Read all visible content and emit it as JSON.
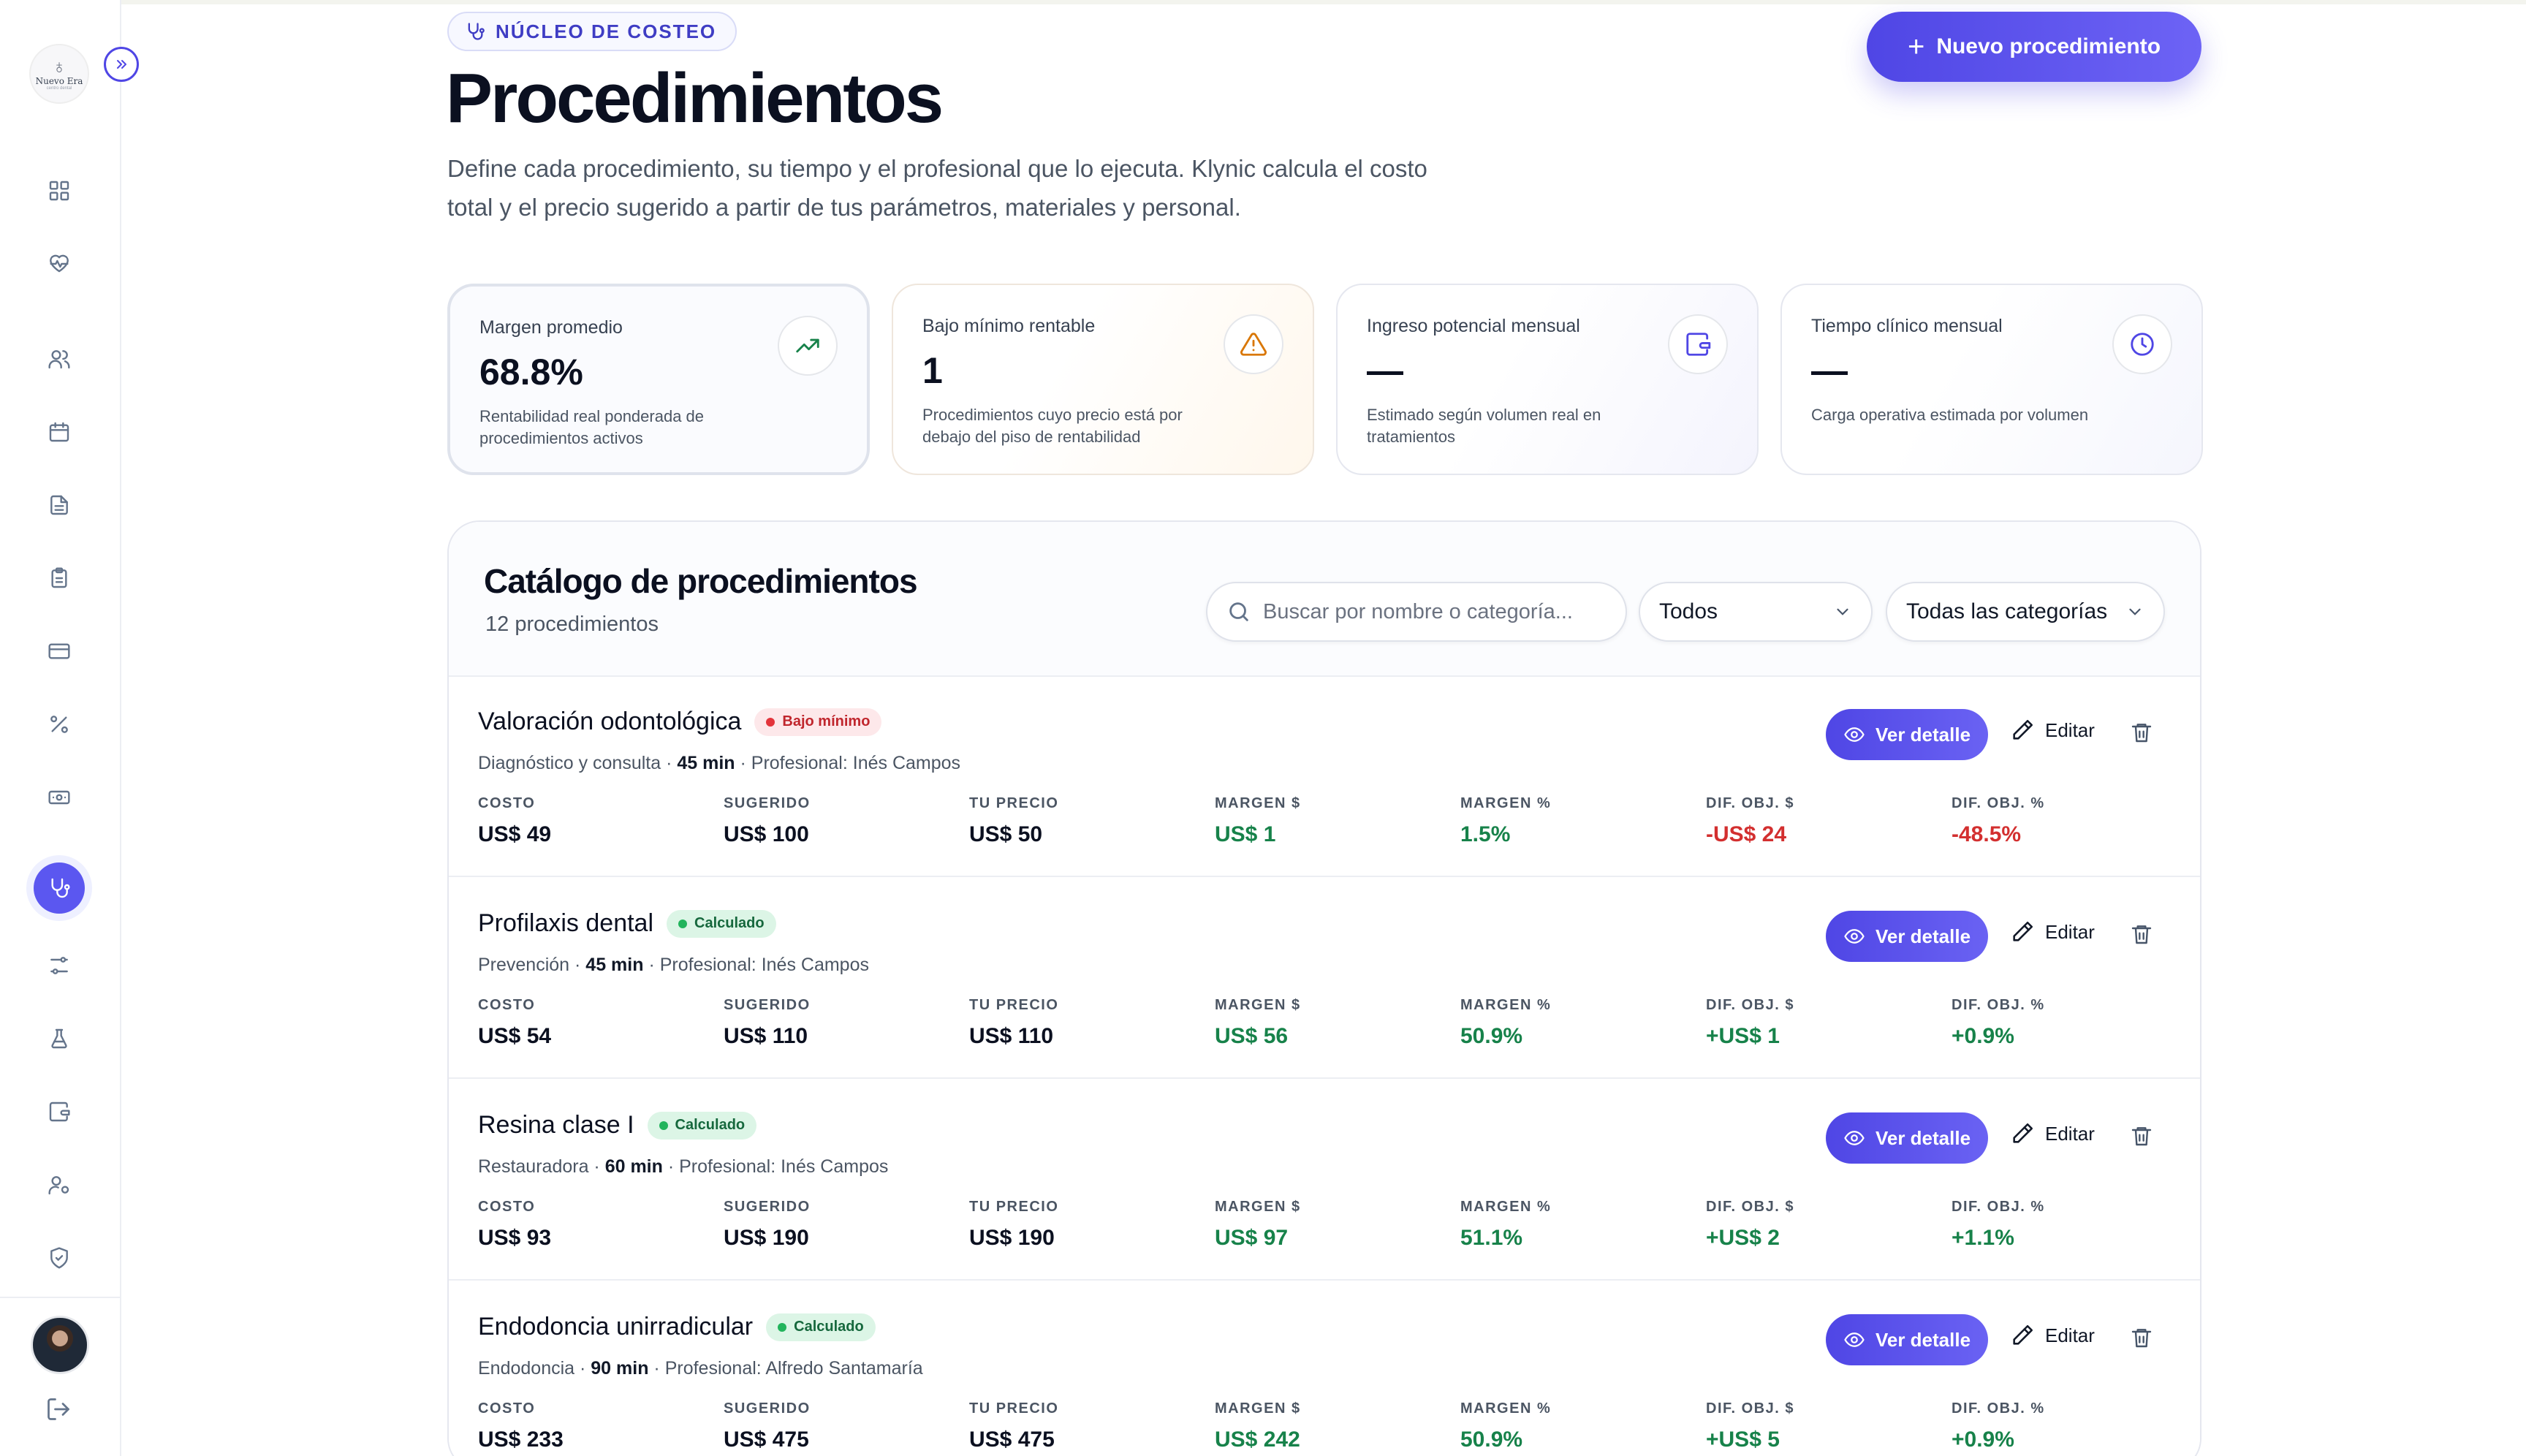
{
  "sidebar": {
    "logo_text": "Nuevo Era",
    "logo_sub": "centro dental",
    "items": [
      {
        "name": "dashboard",
        "icon": "grid-icon"
      },
      {
        "name": "health",
        "icon": "heart-pulse-icon"
      },
      {
        "name": "patients",
        "icon": "users-icon"
      },
      {
        "name": "calendar",
        "icon": "calendar-icon"
      },
      {
        "name": "documents",
        "icon": "file-text-icon"
      },
      {
        "name": "clipboard",
        "icon": "clipboard-icon"
      },
      {
        "name": "billing",
        "icon": "credit-card-icon"
      },
      {
        "name": "percent",
        "icon": "percent-icon"
      },
      {
        "name": "cash",
        "icon": "banknote-icon"
      },
      {
        "name": "procedures",
        "icon": "stethoscope-icon",
        "active": true
      },
      {
        "name": "settings",
        "icon": "sliders-icon"
      },
      {
        "name": "lab",
        "icon": "flask-icon"
      },
      {
        "name": "wallet",
        "icon": "wallet-icon"
      },
      {
        "name": "staff",
        "icon": "user-cog-icon"
      },
      {
        "name": "security",
        "icon": "shield-icon"
      }
    ]
  },
  "header": {
    "eyebrow": "NÚCLEO DE COSTEO",
    "title": "Procedimientos",
    "description_line1": "Define cada procedimiento, su tiempo y el profesional que lo ejecuta. Klynic calcula el costo",
    "description_line2": "total y el precio sugerido a partir de tus parámetros, materiales y personal.",
    "new_button": "Nuevo procedimiento"
  },
  "kpis": [
    {
      "label": "Margen promedio",
      "value": "68.8%",
      "desc": "Rentabilidad real ponderada de procedimientos activos",
      "icon": "trending-up-icon",
      "icon_color": "#17824a"
    },
    {
      "label": "Bajo mínimo rentable",
      "value": "1",
      "desc": "Procedimientos cuyo precio está por debajo del piso de rentabilidad",
      "icon": "alert-triangle-icon",
      "icon_color": "#d97706"
    },
    {
      "label": "Ingreso potencial mensual",
      "value": "—",
      "desc": "Estimado según volumen real en tratamientos",
      "icon": "wallet-icon",
      "icon_color": "#4f46e5"
    },
    {
      "label": "Tiempo clínico mensual",
      "value": "—",
      "desc": "Carga operativa estimada por volumen",
      "icon": "clock-icon",
      "icon_color": "#4f46e5"
    }
  ],
  "catalog": {
    "title": "Catálogo de procedimientos",
    "count": "12 procedimientos",
    "search_placeholder": "Buscar por nombre o categoría...",
    "filter_status": "Todos",
    "filter_category": "Todas las categorías",
    "metric_labels": [
      "COSTO",
      "SUGERIDO",
      "TU PRECIO",
      "MARGEN $",
      "MARGEN %",
      "DIF. OBJ. $",
      "DIF. OBJ. %"
    ],
    "actions": {
      "detail": "Ver detalle",
      "edit": "Editar"
    },
    "professional_label": "Profesional:",
    "rows": [
      {
        "name": "Valoración odontológica",
        "badge": "Bajo mínimo",
        "badge_type": "warn",
        "category": "Diagnóstico y consulta",
        "duration": "45 min",
        "professional": "Inés Campos",
        "values": [
          "US$ 49",
          "US$ 100",
          "US$ 50",
          "US$ 1",
          "1.5%",
          "-US$ 24",
          "-48.5%"
        ],
        "tones": [
          "",
          "",
          "",
          "pos",
          "pos",
          "neg",
          "neg"
        ]
      },
      {
        "name": "Profilaxis dental",
        "badge": "Calculado",
        "badge_type": "ok",
        "category": "Prevención",
        "duration": "45 min",
        "professional": "Inés Campos",
        "values": [
          "US$ 54",
          "US$ 110",
          "US$ 110",
          "US$ 56",
          "50.9%",
          "+US$ 1",
          "+0.9%"
        ],
        "tones": [
          "",
          "",
          "",
          "pos",
          "pos",
          "pos",
          "pos"
        ]
      },
      {
        "name": "Resina clase I",
        "badge": "Calculado",
        "badge_type": "ok",
        "category": "Restauradora",
        "duration": "60 min",
        "professional": "Inés Campos",
        "values": [
          "US$ 93",
          "US$ 190",
          "US$ 190",
          "US$ 97",
          "51.1%",
          "+US$ 2",
          "+1.1%"
        ],
        "tones": [
          "",
          "",
          "",
          "pos",
          "pos",
          "pos",
          "pos"
        ]
      },
      {
        "name": "Endodoncia unirradicular",
        "badge": "Calculado",
        "badge_type": "ok",
        "category": "Endodoncia",
        "duration": "90 min",
        "professional": "Alfredo Santamaría",
        "values": [
          "US$ 233",
          "US$ 475",
          "US$ 475",
          "US$ 242",
          "50.9%",
          "+US$ 5",
          "+0.9%"
        ],
        "tones": [
          "",
          "",
          "",
          "pos",
          "pos",
          "pos",
          "pos"
        ]
      }
    ]
  }
}
